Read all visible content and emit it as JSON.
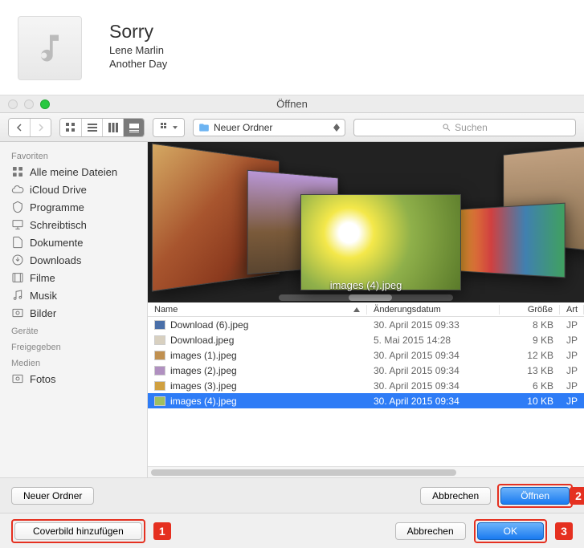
{
  "song": {
    "title": "Sorry",
    "artist": "Lene Marlin",
    "album": "Another Day"
  },
  "dialog": {
    "title": "Öffnen",
    "path": "Neuer Ordner",
    "search_placeholder": "Suchen"
  },
  "sidebar": {
    "sections": {
      "favoriten": "Favoriten",
      "geraete": "Geräte",
      "freigegeben": "Freigegeben",
      "medien": "Medien"
    },
    "items": {
      "all_files": "Alle meine Dateien",
      "icloud": "iCloud Drive",
      "apps": "Programme",
      "desktop": "Schreibtisch",
      "documents": "Dokumente",
      "downloads": "Downloads",
      "movies": "Filme",
      "music": "Musik",
      "pictures": "Bilder",
      "photos": "Fotos"
    }
  },
  "coverflow": {
    "caption": "images (4).jpeg"
  },
  "table": {
    "headers": {
      "name": "Name",
      "date": "Änderungsdatum",
      "size": "Größe",
      "art": "Art"
    },
    "rows": [
      {
        "name": "Download (6).jpeg",
        "date": "30. April 2015 09:33",
        "size": "8 KB",
        "art": "JP",
        "thumb": "#4a6fa8",
        "selected": false
      },
      {
        "name": "Download.jpeg",
        "date": "5. Mai 2015 14:28",
        "size": "9 KB",
        "art": "JP",
        "thumb": "#d8d0c0",
        "selected": false
      },
      {
        "name": "images (1).jpeg",
        "date": "30. April 2015 09:34",
        "size": "12 KB",
        "art": "JP",
        "thumb": "#c09050",
        "selected": false
      },
      {
        "name": "images (2).jpeg",
        "date": "30. April 2015 09:34",
        "size": "13 KB",
        "art": "JP",
        "thumb": "#b090c0",
        "selected": false
      },
      {
        "name": "images (3).jpeg",
        "date": "30. April 2015 09:34",
        "size": "6 KB",
        "art": "JP",
        "thumb": "#d0a040",
        "selected": false
      },
      {
        "name": "images (4).jpeg",
        "date": "30. April 2015 09:34",
        "size": "10 KB",
        "art": "JP",
        "thumb": "#a0c060",
        "selected": true
      }
    ]
  },
  "buttons": {
    "new_folder": "Neuer Ordner",
    "cancel": "Abbrechen",
    "open": "Öffnen",
    "add_cover": "Coverbild hinzufügen",
    "cancel2": "Abbrechen",
    "ok": "OK"
  },
  "callouts": {
    "c1": "1",
    "c2": "2",
    "c3": "3"
  }
}
